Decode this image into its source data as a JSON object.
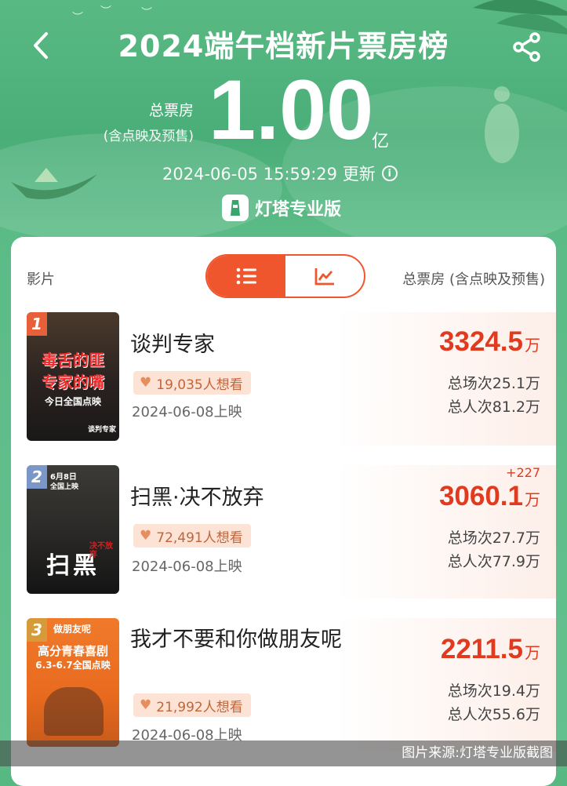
{
  "header": {
    "title": "2024端午档新片票房榜",
    "back_icon": "chevron-left-icon",
    "share_icon": "share-icon"
  },
  "summary": {
    "total_label": "总票房",
    "total_sublabel": "(含点映及预售)",
    "total_value": "1.00",
    "total_unit": "亿",
    "update_time": "2024-06-05 15:59:29 更新",
    "brand": "灯塔专业版"
  },
  "table": {
    "col_film": "影片",
    "col_box": "总票房 (含点映及预售)",
    "view_toggle": [
      "list-icon",
      "trend-chart-icon"
    ],
    "active_view": 0
  },
  "films": [
    {
      "rank": "1",
      "name": "谈判专家",
      "want": "19,035人想看",
      "release": "2024-06-08上映",
      "gross": "3324.5",
      "gross_unit": "万",
      "delta": "",
      "shows": "总场次25.1万",
      "admissions": "总人次81.2万",
      "poster": {
        "line1": "毒舌的匪",
        "line2": "专家的嘴",
        "line3": "今日全国点映",
        "line4": "谈判专家"
      }
    },
    {
      "rank": "2",
      "name": "扫黑·决不放弃",
      "want": "72,491人想看",
      "release": "2024-06-08上映",
      "gross": "3060.1",
      "gross_unit": "万",
      "delta": "+227",
      "shows": "总场次27.7万",
      "admissions": "总人次77.9万",
      "poster": {
        "line1": "6月8日",
        "line2": "全国上映",
        "line3": "扫黑",
        "line4": "决不放弃"
      }
    },
    {
      "rank": "3",
      "name": "我才不要和你做朋友呢",
      "want": "21,992人想看",
      "release": "2024-06-08上映",
      "gross": "2211.5",
      "gross_unit": "万",
      "delta": "",
      "shows": "总场次19.4万",
      "admissions": "总人次55.6万",
      "poster": {
        "line1": "做朋友呢",
        "line2": "高分青春喜剧",
        "line3": "6.3-6.7全国点映",
        "line4": ""
      }
    }
  ],
  "caption": "图片来源:灯塔专业版截图",
  "colors": {
    "accent": "#f0562e",
    "gross": "#e23a1f",
    "header_bg": "#4aae78"
  }
}
